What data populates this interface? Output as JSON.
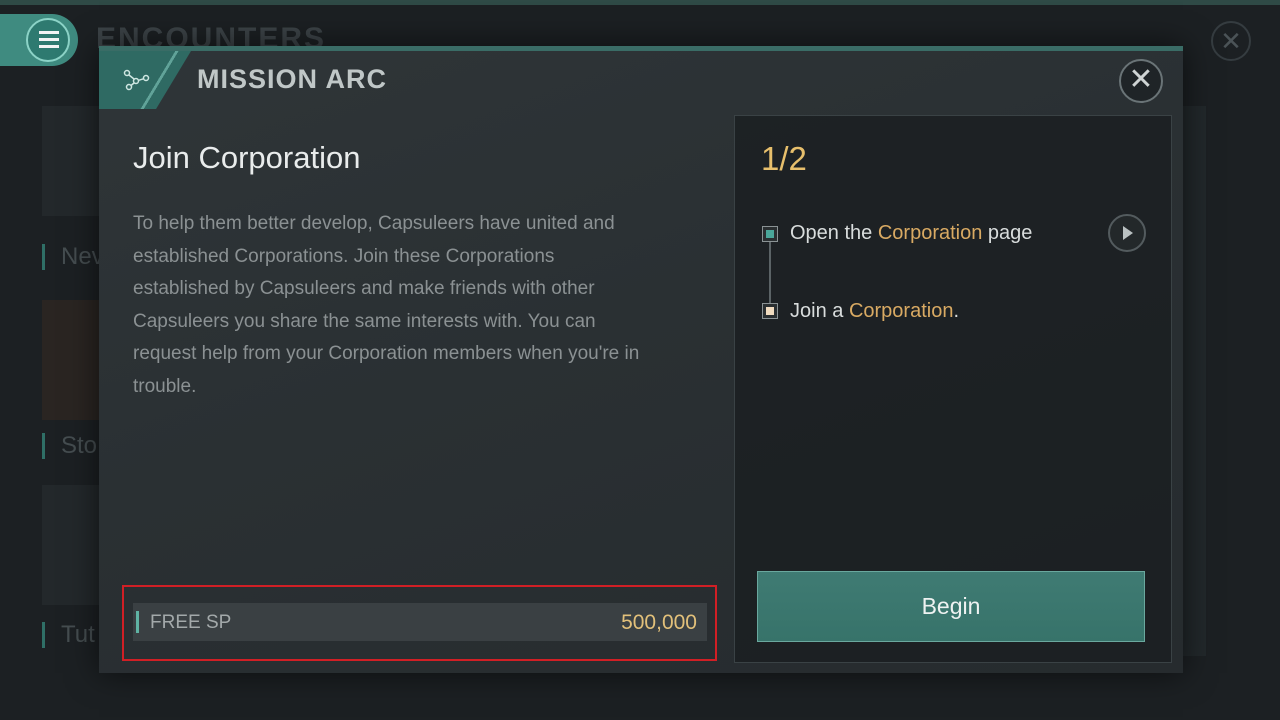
{
  "background": {
    "title": "ENCOUNTERS",
    "cards": [
      "Nev",
      "Sto",
      "Tut"
    ]
  },
  "modal": {
    "header_title": "MISSION ARC",
    "mission_title": "Join Corporation",
    "description": "To help them better develop, Capsuleers have united and established Corporations. Join these Corporations established by Capsuleers and make friends with other Capsuleers you share the same interests with. You can request help from your Corporation members when you're in trouble.",
    "reward": {
      "label": "FREE SP",
      "value": "500,000"
    },
    "progress": "1/2",
    "objectives": [
      {
        "prefix": "Open the ",
        "highlight": "Corporation",
        "suffix": " page"
      },
      {
        "prefix": "Join a ",
        "highlight": "Corporation",
        "suffix": "."
      }
    ],
    "begin_label": "Begin"
  },
  "colors": {
    "accent_teal": "#3f8b80",
    "highlight_gold": "#d9aa63",
    "progress_gold": "#e7bf6c",
    "reward_gold": "#e2c07a",
    "selection_red": "#d11f25"
  },
  "icons": [
    "menu-icon",
    "mission-arc-icon",
    "close-icon",
    "play-arrow-icon"
  ]
}
